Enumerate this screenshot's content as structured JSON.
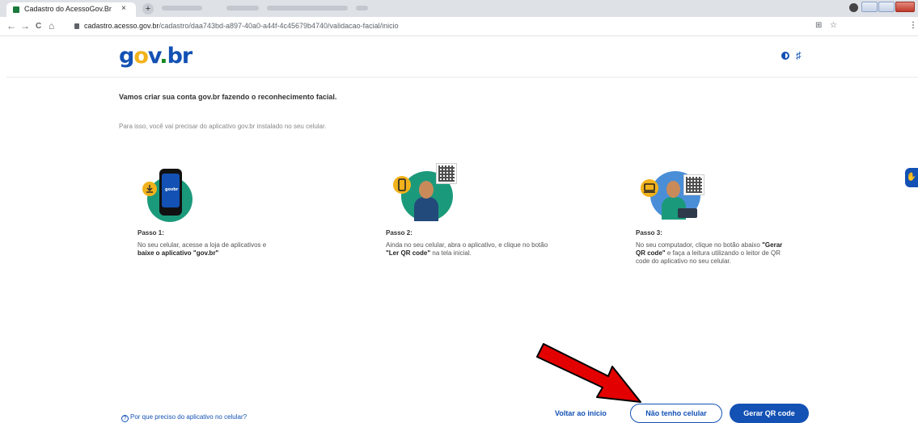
{
  "browser": {
    "tab_title": "Cadastro do AcessoGov.Br",
    "tab_close": "×",
    "new_tab": "+",
    "url_domain": "cadastro.acesso.gov.br",
    "url_path": "/cadastro/daa743bd-a897-40a0-a44f-4c45679b4740/validacao-facial/inicio",
    "back": "←",
    "forward": "→",
    "reload": "C",
    "home": "⌂",
    "translate": "⊞",
    "star": "☆",
    "menu": "⋮"
  },
  "header": {
    "logo_g": "g",
    "logo_o": "o",
    "logo_v": "v",
    "logo_dot": ".",
    "logo_br": "br",
    "vlibras": "♯"
  },
  "main": {
    "title": "Vamos criar sua conta gov.br fazendo o reconhecimento facial.",
    "subtitle": "Para isso, você vai precisar do aplicativo gov.br instalado no seu celular.",
    "steps": [
      {
        "title": "Passo 1:",
        "text_normal": "No seu celular, acesse a loja de aplicativos e",
        "text_bold": "baixe o aplicativo \"gov.br\""
      },
      {
        "title": "Passo 2:",
        "text_normal": "Ainda no seu celular, abra o aplicativo, e clique no botão",
        "text_bold": "\"Ler QR code\"",
        "text_after": "na tela inicial."
      },
      {
        "title": "Passo 3:",
        "text_normal": "No seu computador, clique no botão abaixo",
        "text_bold": "\"Gerar QR code\"",
        "text_after": "e faça a leitura utilizando o leitor de QR code do aplicativo no seu celular."
      }
    ],
    "phone_logo": "govbr"
  },
  "footer": {
    "help_icon": "?",
    "help_text": "Por que preciso do aplicativo no celular?",
    "back_link": "Voltar ao início",
    "no_phone_button": "Não tenho celular",
    "generate_qr_button": "Gerar QR code"
  },
  "side_widget": "✋",
  "colors": {
    "primary": "#1351b4",
    "accent_yellow": "#f2b21b",
    "green": "#168821",
    "teal": "#1b9a7b",
    "arrow": "#e30000"
  }
}
